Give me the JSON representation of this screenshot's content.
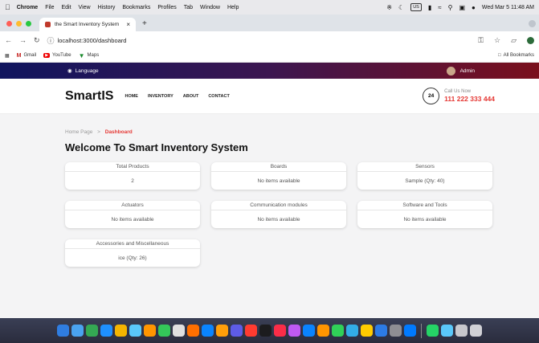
{
  "menubar": {
    "apple": "",
    "app": "Chrome",
    "items": [
      "File",
      "Edit",
      "View",
      "History",
      "Bookmarks",
      "Profiles",
      "Tab",
      "Window",
      "Help"
    ],
    "keyboard": "US",
    "clock": "Wed Mar 5 11:48 AM"
  },
  "browser": {
    "tab_title": "the Smart Inventory System",
    "url": "localhost:3000/dashboard",
    "bookmarks": [
      "Gmail",
      "YouTube",
      "Maps"
    ],
    "all_bookmarks": "All Bookmarks"
  },
  "topbar": {
    "language": "Language",
    "admin": "Admin"
  },
  "header": {
    "logo": "SmartIS",
    "nav": [
      "HOME",
      "INVENTORY",
      "ABOUT",
      "CONTACT"
    ],
    "call_icon_text": "24",
    "call_label": "Call Us Now",
    "phone": "111 222 333 444"
  },
  "breadcrumb": {
    "home": "Home Page",
    "separator": ">",
    "current": "Dashboard"
  },
  "page_title": "Welcome To Smart Inventory System",
  "cards": [
    {
      "title": "Total Products",
      "value": "2"
    },
    {
      "title": "Boards",
      "value": "No items available"
    },
    {
      "title": "Sensors",
      "value": "Sample (Qty: 40)"
    },
    {
      "title": "Actuators",
      "value": "No items available"
    },
    {
      "title": "Communication modules",
      "value": "No items available"
    },
    {
      "title": "Software and Tools",
      "value": "No items available"
    },
    {
      "title": "Accessories and Miscellaneous",
      "value": "ice (Qty: 26)"
    }
  ],
  "colors": {
    "accent_red": "#e53935",
    "topbar_start": "#10155e",
    "topbar_end": "#7a0f1c"
  },
  "dock_colors": [
    "#2f7de1",
    "#4aa3f0",
    "#34a853",
    "#1e90ff",
    "#f4b400",
    "#5ac8fa",
    "#ff9500",
    "#34c759",
    "#e0e0e0",
    "#ff6f00",
    "#0a84ff",
    "#ff9f0a",
    "#5e5ce6",
    "#ff3b30",
    "#1c1c1e",
    "#fa2d48",
    "#bf5af2",
    "#0a84ff",
    "#ff9500",
    "#30d158",
    "#32ade6",
    "#ffcc00",
    "#2c7be5",
    "#8e8e93",
    "#007aff",
    "#25d366",
    "#5ac8fa",
    "#c7c7cc",
    "#d1d1d6"
  ]
}
